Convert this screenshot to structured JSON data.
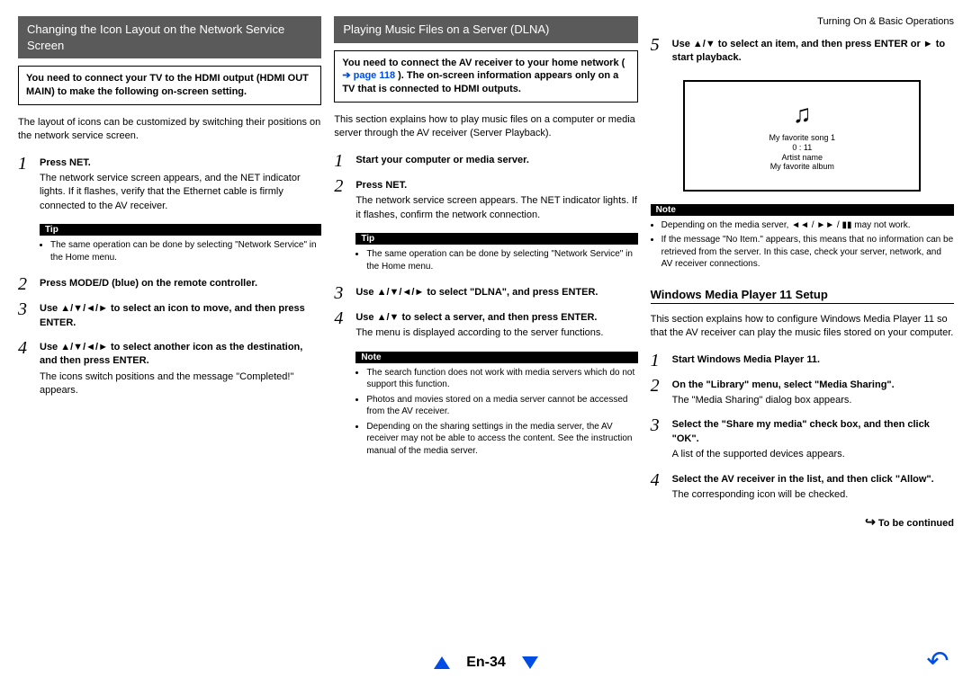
{
  "header": {
    "breadcrumb": "Turning On & Basic Operations"
  },
  "col1": {
    "title": "Changing the Icon Layout on the Network Service Screen",
    "infobox": "You need to connect your TV to the HDMI output (HDMI OUT MAIN) to make the following on-screen setting.",
    "intro": "The layout of icons can be customized by switching their positions on the network service screen.",
    "steps": [
      {
        "n": "1",
        "head": "Press NET.",
        "body": "The network service screen appears, and the NET indicator lights. If it flashes, verify that the Ethernet cable is firmly connected to the AV receiver.",
        "tip": "The same operation can be done by selecting \"Network Service\" in the Home menu."
      },
      {
        "n": "2",
        "head": "Press MODE/D (blue) on the remote controller."
      },
      {
        "n": "3",
        "head": "Use ▲/▼/◄/► to select an icon to move, and then press ENTER."
      },
      {
        "n": "4",
        "head": "Use ▲/▼/◄/► to select another icon as the destination, and then press ENTER.",
        "body": "The icons switch positions and the message \"Completed!\" appears."
      }
    ],
    "labels": {
      "tip": "Tip"
    }
  },
  "col2": {
    "title": "Playing Music Files on a Server (DLNA)",
    "infobox_pre": "You need to connect the AV receiver to your home network (",
    "infobox_link": "➔ page 118",
    "infobox_post": "). The on-screen information appears only on a TV that is connected to HDMI outputs.",
    "intro": "This section explains how to play music files on a computer or media server through the AV receiver (Server Playback).",
    "steps": [
      {
        "n": "1",
        "head": "Start your computer or media server."
      },
      {
        "n": "2",
        "head": "Press NET.",
        "body": "The network service screen appears. The NET indicator lights. If it flashes, confirm the network connection.",
        "tip": "The same operation can be done by selecting \"Network Service\" in the Home menu."
      },
      {
        "n": "3",
        "head": "Use ▲/▼/◄/► to select \"DLNA\", and press ENTER."
      },
      {
        "n": "4",
        "head": "Use ▲/▼ to select a server, and then press ENTER.",
        "body": "The menu is displayed according to the server functions.",
        "notes": [
          "The search function does not work with media servers which do not support this function.",
          "Photos and movies stored on a media server cannot be accessed from the AV receiver.",
          "Depending on the sharing settings in the media server, the AV receiver may not be able to access the content. See the instruction manual of the media server."
        ]
      }
    ],
    "labels": {
      "tip": "Tip",
      "note": "Note"
    }
  },
  "col3": {
    "step5": {
      "n": "5",
      "head": "Use ▲/▼ to select an item, and then press ENTER or ► to start playback.",
      "tv": {
        "line1": "My favorite song 1",
        "line2": "0 : 11",
        "line3": "Artist name",
        "line4": "My favorite album"
      },
      "notes": [
        "Depending on the media server, ◄◄ / ►► / ▮▮ may not work.",
        "If the message \"No Item.\" appears, this means that no information can be retrieved from the server. In this case, check your server, network, and AV receiver connections."
      ]
    },
    "labels": {
      "note": "Note"
    },
    "wmp": {
      "title": "Windows Media Player 11 Setup",
      "intro": "This section explains how to configure Windows Media Player 11 so that the AV receiver can play the music files stored on your computer.",
      "steps": [
        {
          "n": "1",
          "head": "Start Windows Media Player 11."
        },
        {
          "n": "2",
          "head": "On the \"Library\" menu, select \"Media Sharing\".",
          "body": "The \"Media Sharing\" dialog box appears."
        },
        {
          "n": "3",
          "head": "Select the \"Share my media\" check box, and then click \"OK\".",
          "body": "A list of the supported devices appears."
        },
        {
          "n": "4",
          "head": "Select the AV receiver in the list, and then click \"Allow\".",
          "body": "The corresponding icon will be checked."
        }
      ],
      "tbc": "To be continued"
    }
  },
  "footer": {
    "page": "En-34"
  }
}
